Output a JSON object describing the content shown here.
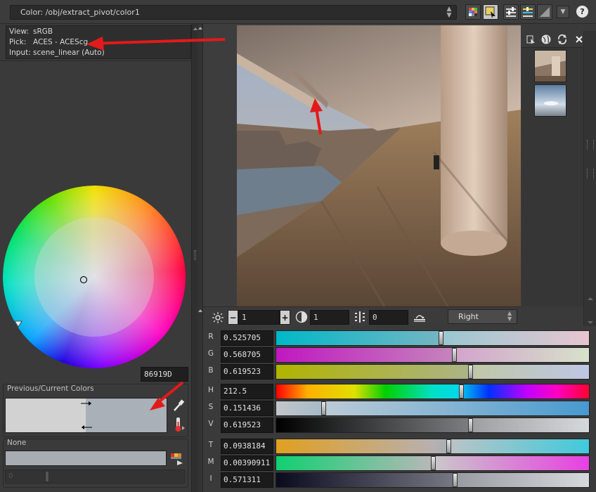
{
  "window": {
    "path": "Color: /obj/extract_pivot/color1",
    "help_label": "?"
  },
  "info": {
    "view_key": "View:",
    "view_value": "sRGB",
    "pick_key": "Pick:",
    "pick_value": "ACES - ACEScg",
    "input_key": "Input:",
    "input_value": "scene_linear (Auto)"
  },
  "hex_value": "86919D",
  "previous_current": {
    "label": "Previous/Current Colors",
    "previous_color": "#d2d2d2",
    "current_color": "#a9b0b8"
  },
  "none_group": {
    "label": "None",
    "field_color": "#a7adb3",
    "slider_value": "0"
  },
  "viewer_tools": {
    "minus_label": "−",
    "zoom_value": "1",
    "plus_label": "+",
    "contrast_value": "1",
    "offset_value": "0",
    "eye_select": "Right"
  },
  "sliders": [
    {
      "label": "R",
      "value": "0.525705",
      "fraction": 0.526,
      "gradient": "linear-gradient(90deg,#00b8c8,#e0b2bf)"
    },
    {
      "label": "G",
      "value": "0.568705",
      "fraction": 0.569,
      "gradient": "linear-gradient(90deg,#c018c0,#c8d8b8)"
    },
    {
      "label": "B",
      "value": "0.619523",
      "fraction": 0.62,
      "gradient": "linear-gradient(90deg,#b0b400,#a8b4dc)"
    },
    {
      "label": "H",
      "value": "212.5",
      "fraction": 0.59,
      "gradient": "linear-gradient(90deg,#ff0000,#ffb000 10%,#e0e000 25%,#00d000 35%,#00e0c8 50%,#00d8e8 58%,#0030ff 68%,#c000ff 80%,#ff00c0 90%,#ff0030)"
    },
    {
      "label": "S",
      "value": "0.151436",
      "fraction": 0.151,
      "gradient": "linear-gradient(90deg,#c2c6ca,#0a78c0)"
    },
    {
      "label": "V",
      "value": "0.619523",
      "fraction": 0.62,
      "gradient": "linear-gradient(90deg,#000000,#c8ccd0)"
    },
    {
      "label": "T",
      "value": "0.0938184",
      "fraction": 0.55,
      "gradient": "linear-gradient(90deg,#e0a020,#b8b0b0 50%,#00b8d0)"
    },
    {
      "label": "M",
      "value": "0.00390911",
      "fraction": 0.501,
      "gradient": "linear-gradient(90deg,#10d070,#b8b8b8 50%,#e000d8)"
    },
    {
      "label": "I",
      "value": "0.571311",
      "fraction": 0.571,
      "gradient": "linear-gradient(90deg,#0a0a1e,#c8ccd0)"
    }
  ]
}
